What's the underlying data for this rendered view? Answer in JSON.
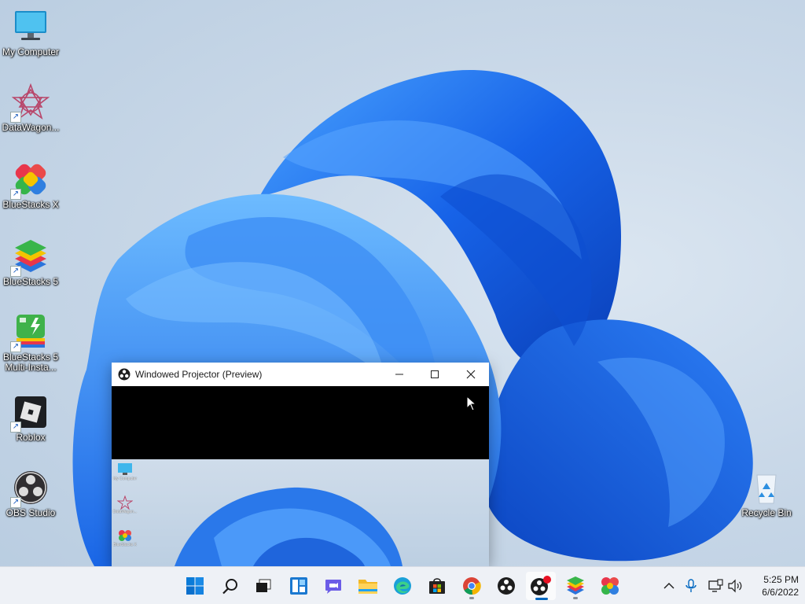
{
  "desktop": {
    "icons": [
      {
        "label": "My Computer",
        "icon": "monitor-icon"
      },
      {
        "label": "DataWagon...",
        "icon": "datawagon-icon"
      },
      {
        "label": "BlueStacks X",
        "icon": "bluestacks-x-icon"
      },
      {
        "label": "BlueStacks 5",
        "icon": "bluestacks-5-icon"
      },
      {
        "label": "BlueStacks 5 Multi-Insta...",
        "icon": "bluestacks-multi-icon"
      },
      {
        "label": "Roblox",
        "icon": "roblox-icon"
      },
      {
        "label": "OBS Studio",
        "icon": "obs-icon"
      },
      {
        "label": "Recycle Bin",
        "icon": "recycle-bin-icon"
      }
    ]
  },
  "projector_window": {
    "title": "Windowed Projector (Preview)",
    "preview_icons": [
      {
        "label": "My Computer"
      },
      {
        "label": "DataWagon..."
      },
      {
        "label": "BlueStacks X"
      }
    ]
  },
  "taskbar": {
    "apps": [
      {
        "name": "Start",
        "icon": "windows-start-icon"
      },
      {
        "name": "Search",
        "icon": "search-icon"
      },
      {
        "name": "Task View",
        "icon": "task-view-icon"
      },
      {
        "name": "Widgets",
        "icon": "widgets-icon"
      },
      {
        "name": "Chat",
        "icon": "chat-icon"
      },
      {
        "name": "File Explorer",
        "icon": "folder-icon"
      },
      {
        "name": "Microsoft Edge",
        "icon": "edge-icon"
      },
      {
        "name": "Microsoft Store",
        "icon": "store-icon"
      },
      {
        "name": "Google Chrome",
        "icon": "chrome-icon"
      },
      {
        "name": "OBS Studio",
        "icon": "obs-icon"
      },
      {
        "name": "OBS Studio (recording)",
        "icon": "obs-recording-icon"
      },
      {
        "name": "BlueStacks 5",
        "icon": "bluestacks-5-icon"
      },
      {
        "name": "BlueStacks X",
        "icon": "bluestacks-x-icon"
      }
    ],
    "tray": {
      "chevron": "chevron-up-icon",
      "mic": "microphone-icon",
      "network": "network-icon",
      "volume": "volume-icon"
    },
    "clock": {
      "time": "5:25 PM",
      "date": "6/6/2022"
    }
  },
  "colors": {
    "accent": "#0067c0",
    "bloom": "#1f6fe0",
    "taskbar_bg": "#eef1f6",
    "recording_dot": "#e81123"
  }
}
